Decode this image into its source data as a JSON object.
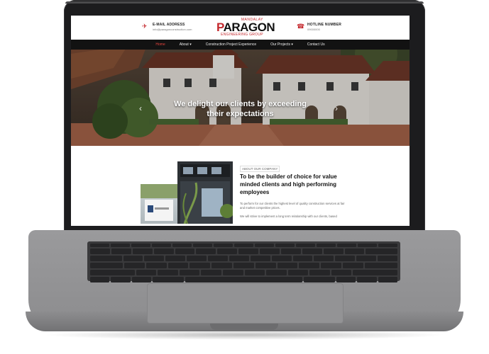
{
  "site": {
    "contact_email": {
      "label": "E-MAIL ADDRESS",
      "value": "info@paragonconstruction.com"
    },
    "contact_hotline": {
      "label": "HOTLINE NUMBER",
      "value": "09000000"
    },
    "logo": {
      "top": "MANDALAY",
      "main_prefix": "P",
      "main_rest": "ARAGON",
      "sub": "ENGINEERING GROUP"
    },
    "nav": [
      {
        "label": "Home",
        "active": true
      },
      {
        "label": "About ▾"
      },
      {
        "label": "Construction Project Experience"
      },
      {
        "label": "Our Projects ▾"
      },
      {
        "label": "Contact Us"
      }
    ],
    "hero": {
      "line1": "We delight our clients by exceeding",
      "line2": "their expectations"
    },
    "about": {
      "tag": "ABOUT OUR COMPANY",
      "title": "To be the builder of choice for value minded clients and high performing employees",
      "p1": "To perform for our clients the highest level of quality construction services at fair and market competitive prices.",
      "p2": "We will strive to implement a long term relationship with our clients, based"
    }
  },
  "colors": {
    "brand_red": "#c4282d",
    "nav_bg": "#121212"
  },
  "icons": {
    "email": "paper-plane-icon",
    "hotline": "phone-icon",
    "prev": "chevron-left-icon",
    "next": "chevron-right-icon"
  }
}
